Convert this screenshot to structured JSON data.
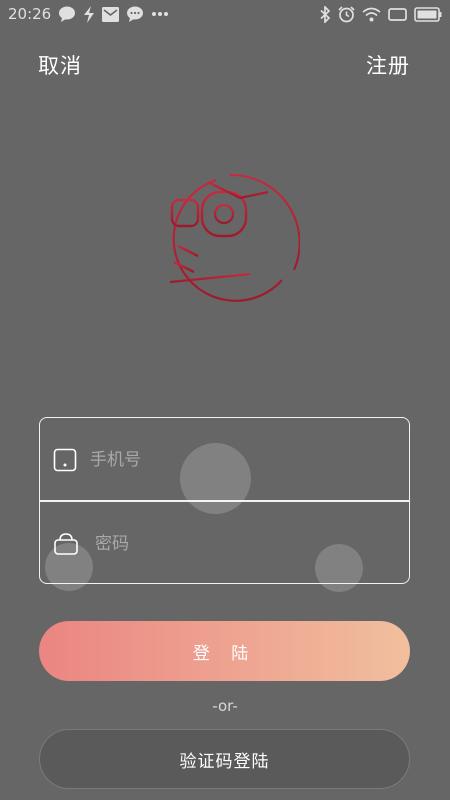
{
  "status_bar": {
    "time": "20:26",
    "left_icons": [
      "chat-bubble-icon",
      "lightning-icon",
      "mail-icon",
      "chat-bubble-icon",
      "more-dots-icon"
    ],
    "right_icons": [
      "bluetooth-icon",
      "alarm-icon",
      "wifi-icon",
      "screen-icon",
      "battery-icon"
    ]
  },
  "nav": {
    "cancel_label": "取消",
    "register_label": "注册"
  },
  "colors": {
    "background": "#666666",
    "logo_red": "#b31e33",
    "button_gradient_start": "#eb8582",
    "button_gradient_end": "#f1bf9e"
  },
  "form": {
    "phone_placeholder": "手机号",
    "password_placeholder": "密码"
  },
  "actions": {
    "login_label": "登 陆",
    "or_label": "-or-",
    "code_login_label": "验证码登陆"
  }
}
